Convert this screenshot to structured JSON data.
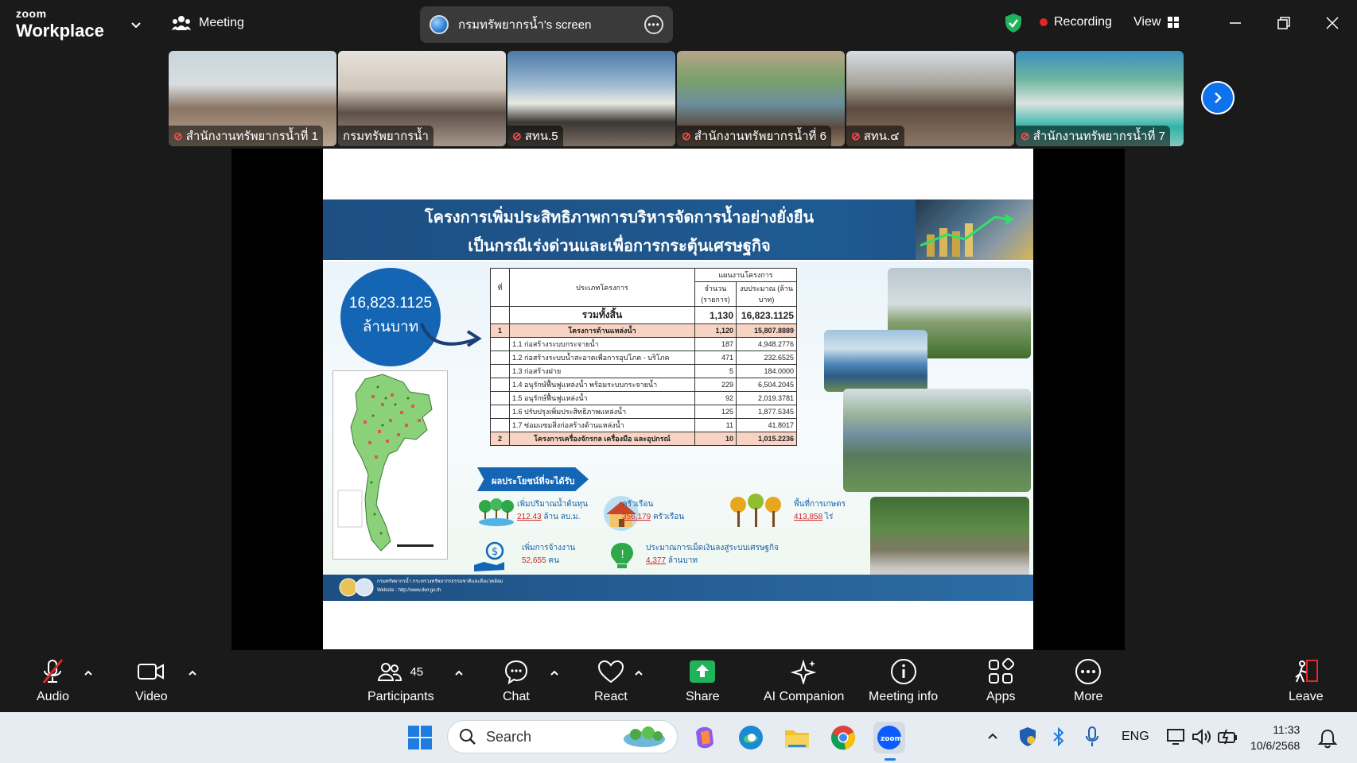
{
  "app": {
    "logo_top": "zoom",
    "logo_bottom": "Workplace",
    "meeting_label": "Meeting",
    "share_label": "กรมทรัพยากรน้ำ's screen",
    "recording_label": "Recording",
    "view_label": "View"
  },
  "thumbnails": [
    {
      "label": "สำนักงานทรัพยากรน้ำที่ 1",
      "muted": true,
      "active": false
    },
    {
      "label": "กรมทรัพยากรน้ำ",
      "muted": false,
      "active": true
    },
    {
      "label": "สทน.5",
      "muted": true,
      "active": false
    },
    {
      "label": "สำนักงานทรัพยากรน้ำที่ 6",
      "muted": true,
      "active": false
    },
    {
      "label": "สทน.๔",
      "muted": true,
      "active": false
    },
    {
      "label": "สำนักงานทรัพยากรน้ำที่ 7",
      "muted": true,
      "active": false
    }
  ],
  "slide": {
    "title_line1": "โครงการเพิ่มประสิทธิภาพการบริหารจัดการน้ำอย่างยั่งยืน",
    "title_line2": "เป็นกรณีเร่งด่วนและเพื่อการกระตุ้นเศรษฐกิจ",
    "budget_value": "16,823.1125",
    "budget_unit": "ล้านบาท",
    "table": {
      "h_no": "ที่",
      "h_type": "ประเภทโครงการ",
      "h_plan": "แผนงานโครงการ",
      "h_count": "จำนวน (รายการ)",
      "h_budget": "งบประมาณ (ล้านบาท)",
      "total_label": "รวมทั้งสิ้น",
      "total_count": "1,130",
      "total_budget": "16,823.1125",
      "rows": [
        {
          "no": "1",
          "name": "โครงการด้านแหล่งน้ำ",
          "count": "1,120",
          "budget": "15,807.8889",
          "cat": true
        },
        {
          "no": "",
          "name": "1.1 ก่อสร้างระบบกระจายน้ำ",
          "count": "187",
          "budget": "4,948.2776",
          "cat": false
        },
        {
          "no": "",
          "name": "1.2 ก่อสร้างระบบน้ำสะอาดเพื่อการอุปโภค - บริโภค",
          "count": "471",
          "budget": "232.6525",
          "cat": false
        },
        {
          "no": "",
          "name": "1.3 ก่อสร้างฝาย",
          "count": "5",
          "budget": "184.0000",
          "cat": false
        },
        {
          "no": "",
          "name": "1.4 อนุรักษ์ฟื้นฟูแหล่งน้ำ พร้อมระบบกระจายน้ำ",
          "count": "229",
          "budget": "6,504.2045",
          "cat": false
        },
        {
          "no": "",
          "name": "1.5 อนุรักษ์ฟื้นฟูแหล่งน้ำ",
          "count": "92",
          "budget": "2,019.3781",
          "cat": false
        },
        {
          "no": "",
          "name": "1.6 ปรับปรุงเพิ่มประสิทธิภาพแหล่งน้ำ",
          "count": "125",
          "budget": "1,877.5345",
          "cat": false
        },
        {
          "no": "",
          "name": "1.7 ซ่อมแซมสิ่งก่อสร้างด้านแหล่งน้ำ",
          "count": "11",
          "budget": "41.8017",
          "cat": false
        },
        {
          "no": "2",
          "name": "โครงการเครื่องจักรกล เครื่องมือ และอุปกรณ์",
          "count": "10",
          "budget": "1,015.2236",
          "cat": true
        }
      ]
    },
    "benefit_title": "ผลประโยชน์ที่จะได้รับ",
    "benefits": {
      "water_label": "เพิ่มปริมาณน้ำต้นทุน",
      "water_value": "212.43",
      "water_unit": "ล้าน ลบ.ม.",
      "house_label": "ครัวเรือน",
      "house_value": "356,179",
      "house_unit": "ครัวเรือน",
      "farm_label": "พื้นที่การเกษตร",
      "farm_value": "413,858",
      "farm_unit": "ไร่",
      "job_label": "เพิ่มการจ้างงาน",
      "job_value": "52,655",
      "job_unit": "คน",
      "econ_label": "ประมาณการเม็ดเงินลงสู่ระบบเศรษฐกิจ",
      "econ_value": "4,377",
      "econ_unit": "ล้านบาท"
    },
    "footer_line1": "กรมทรัพยากรน้ำ กระทรวงทรัพยากรธรรมชาติและสิ่งแวดล้อม",
    "footer_line2": "Website : http://www.dwr.go.th"
  },
  "toolbar": {
    "audio": "Audio",
    "video": "Video",
    "participants": "Participants",
    "participants_count": "45",
    "chat": "Chat",
    "react": "React",
    "share": "Share",
    "ai": "AI Companion",
    "info": "Meeting info",
    "apps": "Apps",
    "more": "More",
    "leave": "Leave"
  },
  "taskbar": {
    "search_placeholder": "Search",
    "lang": "ENG",
    "time": "11:33",
    "date": "10/6/2568"
  },
  "colors": {
    "accent": "#0e72ed",
    "share_green": "#1fb35a",
    "record_red": "#e02828",
    "slide_blue": "#1565b5"
  }
}
